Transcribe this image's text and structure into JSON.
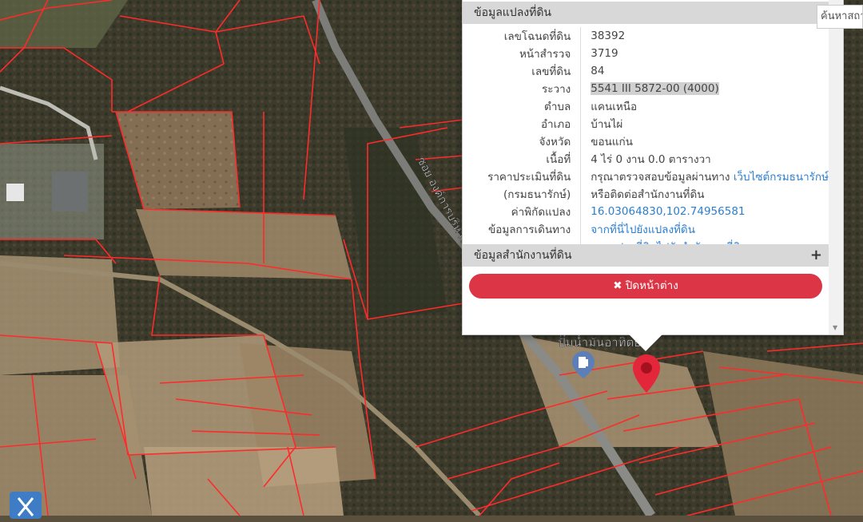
{
  "popup": {
    "header_title": "ข้อมูลแปลงที่ดิน",
    "rows": [
      {
        "label": "เลขโฉนดที่ดิน",
        "value": "38392"
      },
      {
        "label": "หน้าสำรวจ",
        "value": "3719"
      },
      {
        "label": "เลขที่ดิน",
        "value": "84"
      },
      {
        "label": "ระวาง",
        "value": "5541 III 5872-00 (4000)"
      },
      {
        "label": "ตำบล",
        "value": "แคนเหนือ"
      },
      {
        "label": "อำเภอ",
        "value": "บ้านไผ่"
      },
      {
        "label": "จังหวัด",
        "value": "ขอนแก่น"
      },
      {
        "label": "เนื้อที่",
        "value": "4 ไร่ 0 งาน 0.0 ตารางวา"
      }
    ],
    "price": {
      "label_1": "ราคาประเมินที่ดิน",
      "label_2": "(กรมธนารักษ์)",
      "value_1": "กรุณาตรวจสอบข้อมูลผ่านทาง",
      "link": "เว็บไซต์กรมธนารักษ์",
      "value_2": "หรือติดต่อสำนักงานที่ดิน"
    },
    "coords": {
      "label": "ค่าพิกัดแปลง",
      "value": "16.03064830,102.74956581"
    },
    "travel": {
      "label": "ข้อมูลการเดินทาง",
      "link_1": "จากที่นี่ไปยังแปลงที่ดิน",
      "link_2": "จากแปลงที่ดินไปยังสำนักงานที่ดิน"
    },
    "office_header": "ข้อมูลสำนักงานที่ดิน",
    "plus_icon": "+",
    "close_label": "✖ ปิดหน้าต่าง"
  },
  "search": {
    "placeholder": "ค้นหาสถานที่"
  },
  "map": {
    "road_label": "ซอย องค์การบริหาร",
    "poi_label": "ปั๊มน้ำมันอาทิตย์"
  },
  "colors": {
    "accent_red": "#dc3545",
    "parcel_line": "#ff2a2a",
    "link": "#2b7fd0",
    "tool_button": "#3e7cc6"
  }
}
